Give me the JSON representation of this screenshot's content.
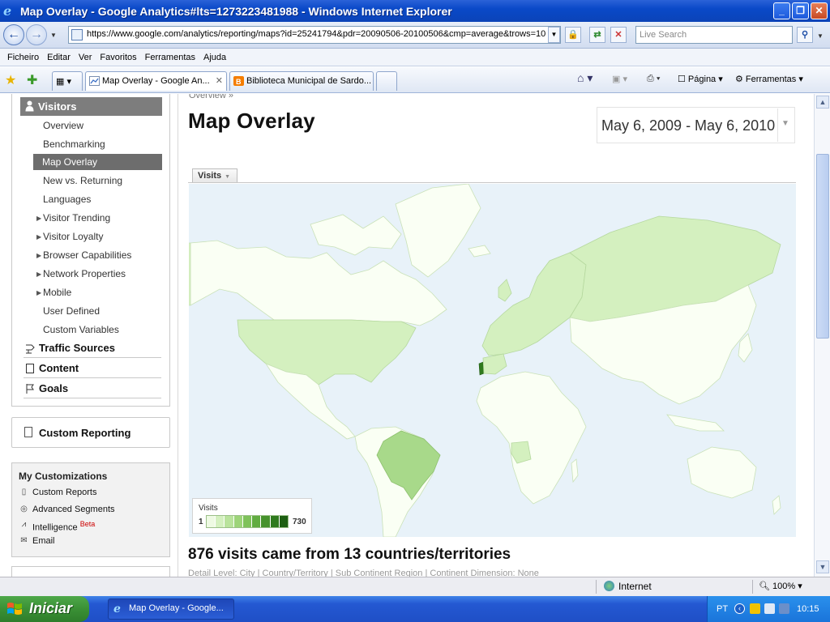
{
  "window": {
    "title": "Map Overlay - Google Analytics#lts=1273223481988 - Windows Internet Explorer",
    "minimize": "_",
    "maximize": "❐",
    "close": "✕"
  },
  "address_bar": {
    "url": "https://www.google.com/analytics/reporting/maps?id=25241794&pdr=20090506-20100506&cmp=average&trows=10",
    "search_placeholder": "Live Search"
  },
  "menu": [
    "Ficheiro",
    "Editar",
    "Ver",
    "Favoritos",
    "Ferramentas",
    "Ajuda"
  ],
  "tabs": [
    {
      "label": "Map Overlay - Google An...",
      "active": true
    },
    {
      "label": "Biblioteca Municipal de Sardo...",
      "active": false
    }
  ],
  "toolbar": {
    "page_label": "Página",
    "tools_label": "Ferramentas"
  },
  "sidebar": {
    "visitors_label": "Visitors",
    "visitor_items": [
      {
        "label": "Overview",
        "expandable": false
      },
      {
        "label": "Benchmarking",
        "expandable": false
      },
      {
        "label": "Map Overlay",
        "expandable": false,
        "selected": true
      },
      {
        "label": "New vs. Returning",
        "expandable": false
      },
      {
        "label": "Languages",
        "expandable": false
      },
      {
        "label": "Visitor Trending",
        "expandable": true
      },
      {
        "label": "Visitor Loyalty",
        "expandable": true
      },
      {
        "label": "Browser Capabilities",
        "expandable": true
      },
      {
        "label": "Network Properties",
        "expandable": true
      },
      {
        "label": "Mobile",
        "expandable": true
      },
      {
        "label": "User Defined",
        "expandable": false
      },
      {
        "label": "Custom Variables",
        "expandable": false
      }
    ],
    "sections": [
      "Traffic Sources",
      "Content",
      "Goals"
    ],
    "custom_reporting": "Custom Reporting",
    "my_customizations": {
      "heading": "My Customizations",
      "items": [
        {
          "label": "Custom Reports",
          "icon": "report-icon"
        },
        {
          "label": "Advanced Segments",
          "icon": "segments-icon"
        },
        {
          "label": "Intelligence",
          "icon": "intelligence-icon",
          "badge": "Beta"
        },
        {
          "label": "Email",
          "icon": "email-icon"
        }
      ]
    }
  },
  "main": {
    "breadcrumb": "Overview »",
    "title": "Map Overlay",
    "date_range": "May 6, 2009 - May 6, 2010",
    "metric_selector": "Visits",
    "legend": {
      "title": "Visits",
      "min": "1",
      "max": "730"
    },
    "summary": "876 visits came from 13 countries/territories",
    "detail_row": "Detail Level: City | Country/Territory | Sub Continent Region | Continent   Dimension: None"
  },
  "map_colors": {
    "ocean": "#e8f2f9",
    "no_data": "#fafff4",
    "low": "#d4f0bf",
    "mid": "#a8d98a",
    "max": "#2f7a1e"
  },
  "status_bar": {
    "zone": "Internet",
    "zoom": "100%"
  },
  "taskbar": {
    "start": "Iniciar",
    "task": "Map Overlay - Google...",
    "lang": "PT",
    "clock": "10:15"
  }
}
